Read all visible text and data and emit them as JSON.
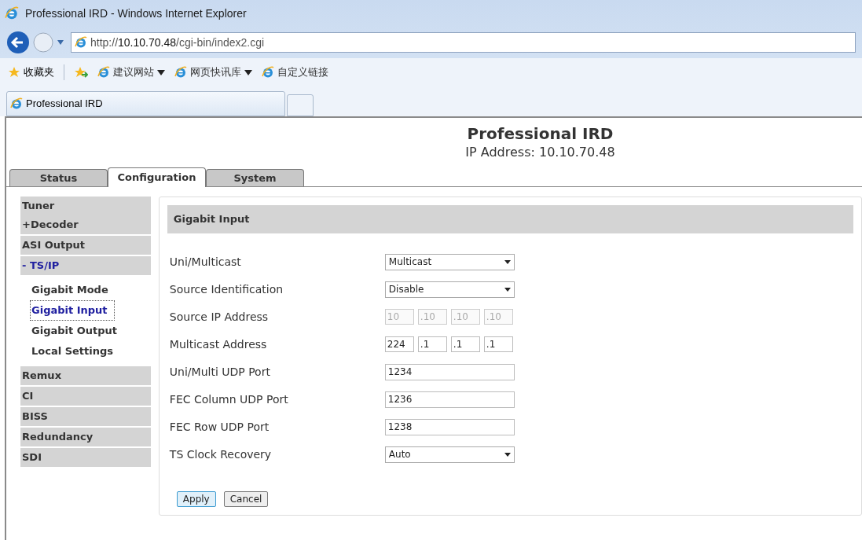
{
  "window": {
    "title": "Professional IRD - Windows Internet Explorer"
  },
  "address_bar": {
    "prefix": "http://",
    "host": "10.10.70.48",
    "path": "/cgi-bin/index2.cgi"
  },
  "favorites_bar": [
    {
      "kind": "favorites",
      "label": "收藏夹"
    },
    {
      "kind": "add"
    },
    {
      "kind": "link",
      "label": "建议网站",
      "dropdown": true
    },
    {
      "kind": "link",
      "label": "网页快讯库",
      "dropdown": true
    },
    {
      "kind": "link",
      "label": "自定义链接",
      "dropdown": false
    }
  ],
  "browser_tabs": [
    {
      "label": "Professional IRD",
      "selected": true
    }
  ],
  "page": {
    "title": "Professional IRD",
    "subtitle": "IP Address: 10.10.70.48"
  },
  "tabs": [
    {
      "label": "Status",
      "selected": false
    },
    {
      "label": "Configuration",
      "selected": true
    },
    {
      "label": "System",
      "selected": false
    }
  ],
  "sidebar": {
    "items": [
      {
        "label": "Tuner\n+Decoder",
        "expanded": false
      },
      {
        "label": "ASI Output",
        "expanded": false
      },
      {
        "label": "- TS/IP",
        "expanded": true,
        "children": [
          {
            "label": "Gigabit Mode",
            "selected": false
          },
          {
            "label": "Gigabit Input",
            "selected": true
          },
          {
            "label": "Gigabit Output",
            "selected": false
          },
          {
            "label": "Local Settings",
            "selected": false
          }
        ]
      },
      {
        "label": "Remux",
        "expanded": false
      },
      {
        "label": "CI",
        "expanded": false
      },
      {
        "label": "BISS",
        "expanded": false
      },
      {
        "label": "Redundancy",
        "expanded": false
      },
      {
        "label": "SDI",
        "expanded": false
      }
    ]
  },
  "panel": {
    "title": "Gigabit Input",
    "fields": [
      {
        "kind": "select",
        "label": "Uni/Multicast",
        "value": "Multicast"
      },
      {
        "kind": "select",
        "label": "Source Identification",
        "value": "Disable"
      },
      {
        "kind": "ip",
        "label": "Source IP Address",
        "octets": [
          "10",
          ".10",
          ".10",
          ".10"
        ],
        "disabled": true
      },
      {
        "kind": "ip",
        "label": "Multicast Address",
        "octets": [
          "224",
          ".1",
          ".1",
          ".1"
        ],
        "disabled": false
      },
      {
        "kind": "text",
        "label": "Uni/Multi UDP Port",
        "value": "1234"
      },
      {
        "kind": "text",
        "label": "FEC Column UDP Port",
        "value": "1236"
      },
      {
        "kind": "text",
        "label": "FEC Row UDP Port",
        "value": "1238"
      },
      {
        "kind": "select",
        "label": "TS Clock Recovery",
        "value": "Auto"
      }
    ],
    "buttons": [
      {
        "label": "Apply",
        "focused": true
      },
      {
        "label": "Cancel",
        "focused": false
      }
    ]
  }
}
